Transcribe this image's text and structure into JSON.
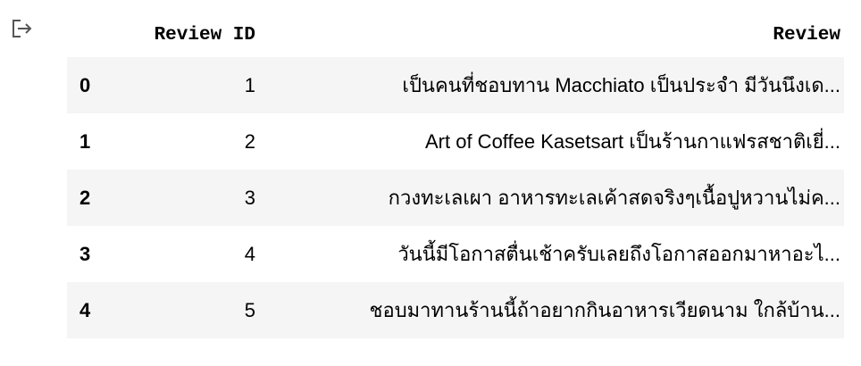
{
  "output_icon": "output-arrow-icon",
  "table": {
    "index_header": "",
    "columns": [
      "Review ID",
      "Review"
    ],
    "rows": [
      {
        "index": "0",
        "review_id": "1",
        "review": "เป็นคนที่ชอบทาน Macchiato เป็นประจำ มีวันนึงเด..."
      },
      {
        "index": "1",
        "review_id": "2",
        "review": "Art of Coffee Kasetsart เป็นร้านกาแฟรสชาติเยี่..."
      },
      {
        "index": "2",
        "review_id": "3",
        "review": "กวงทะเลเผา อาหารทะเลเค้าสดจริงๆเนื้อปูหวานไม่ค..."
      },
      {
        "index": "3",
        "review_id": "4",
        "review": "วันนี้มีโอกาสตื่นเช้าครับเลยถึงโอกาสออกมาหาอะไ..."
      },
      {
        "index": "4",
        "review_id": "5",
        "review": "ชอบมาทานร้านนี้ถ้าอยากกินอาหารเวียดนาม ใกล้บ้าน..."
      }
    ]
  }
}
